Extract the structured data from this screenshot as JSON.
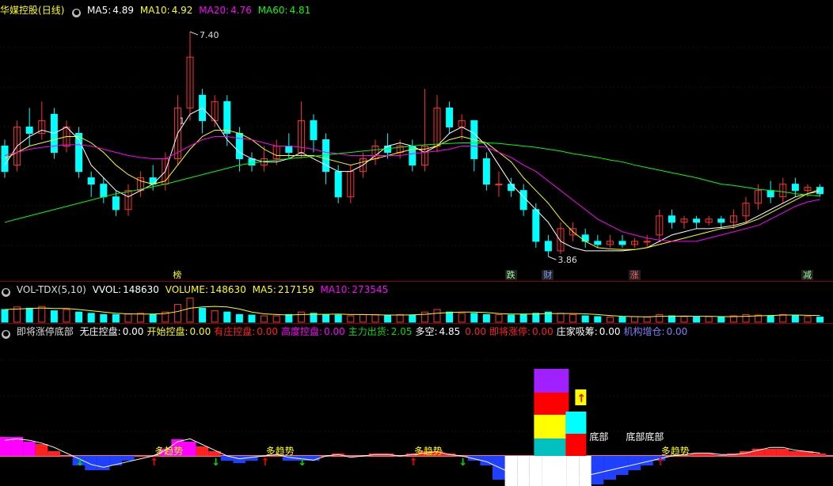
{
  "header_main": {
    "stock": "华媒控股",
    "period": "(日线)",
    "ma5_label": "MA5:",
    "ma5": "4.89",
    "ma10_label": "MA10:",
    "ma10": "4.92",
    "ma20_label": "MA20:",
    "ma20": "4.76",
    "ma60_label": "MA60:",
    "ma60": "4.81"
  },
  "header_vol": {
    "name": "VOL-TDX(5,10)",
    "vvol_label": "VVOL:",
    "vvol": "148630",
    "volume_label": "VOLUME:",
    "volume": "148630",
    "ma5_label": "MA5:",
    "ma5": "217159",
    "ma10_label": "MA10:",
    "ma10": "273545"
  },
  "header_ind": {
    "name": "即将涨停底部",
    "items": [
      {
        "label": "无庄控盘:",
        "value": "0.00",
        "color": "#ffffff"
      },
      {
        "label": "开始控盘:",
        "value": "0.00",
        "color": "#ffff00"
      },
      {
        "label": "有庄控盘:",
        "value": "0.00",
        "color": "#ff2020"
      },
      {
        "label": "高度控盘:",
        "value": "0.00",
        "color": "#ff00ff"
      },
      {
        "label": "主力出货:",
        "value": "2.05",
        "color": "#00dd00"
      },
      {
        "label": "多空:",
        "value": "4.85",
        "color": "#ffffff"
      },
      {
        "label": "",
        "value": "0.00",
        "color": "#ff2020"
      },
      {
        "label": "即将涨停:",
        "value": "0.00",
        "color": "#ff2020"
      },
      {
        "label": "庄家吸筹:",
        "value": "0.00",
        "color": "#ffffff"
      },
      {
        "label": "机构增仓:",
        "value": "0.00",
        "color": "#8080ff"
      }
    ]
  },
  "colors": {
    "up": "#ff3232",
    "down": "#00ffff",
    "ma5": "#ffffff",
    "ma10": "#ffff00",
    "ma20": "#ff00ff",
    "ma60": "#00ff00",
    "separator": "#8b0000"
  },
  "annotations": {
    "high": "7.40",
    "low": "3.86",
    "marker_1": "1",
    "event_tags": [
      "榜",
      "跌",
      "财",
      "涨",
      "减"
    ],
    "bottom_labels": [
      "底部",
      "底部底部"
    ],
    "trend_label": "多趋势"
  },
  "chart_data": [
    {
      "type": "candlestick",
      "title": "华媒控股 (日线)",
      "ylim": [
        3.6,
        7.6
      ],
      "series": [
        {
          "name": "MA5",
          "values": [
            5.3,
            5.6,
            5.75,
            5.85,
            5.8,
            5.9,
            5.7,
            5.3,
            5.1,
            4.9,
            4.8,
            4.9,
            5.0,
            5.2,
            5.8,
            6.1,
            6.2,
            6.0,
            5.7,
            5.5,
            5.4,
            5.35,
            5.35,
            5.4,
            5.5,
            5.4,
            5.3,
            5.2,
            5.2,
            5.3,
            5.45,
            5.6,
            5.65,
            5.6,
            5.5,
            5.6,
            5.8,
            5.9,
            5.8,
            5.6,
            5.3,
            5.0,
            4.8,
            4.6,
            4.4,
            4.1,
            4.0,
            3.95,
            3.95,
            3.95,
            3.95,
            3.97,
            4.0,
            4.1,
            4.2,
            4.25,
            4.3,
            4.3,
            4.32,
            4.35,
            4.4,
            4.5,
            4.6,
            4.7,
            4.8,
            4.85,
            4.89
          ]
        },
        {
          "name": "MA10",
          "values": [
            5.4,
            5.5,
            5.6,
            5.65,
            5.7,
            5.75,
            5.75,
            5.65,
            5.5,
            5.3,
            5.15,
            5.05,
            5.0,
            5.05,
            5.3,
            5.55,
            5.75,
            5.85,
            5.85,
            5.8,
            5.7,
            5.55,
            5.45,
            5.45,
            5.45,
            5.45,
            5.4,
            5.35,
            5.3,
            5.35,
            5.4,
            5.45,
            5.5,
            5.55,
            5.55,
            5.6,
            5.7,
            5.75,
            5.7,
            5.65,
            5.5,
            5.35,
            5.1,
            4.9,
            4.7,
            4.45,
            4.25,
            4.1,
            4.0,
            3.98,
            3.97,
            3.97,
            4.0,
            4.05,
            4.1,
            4.15,
            4.2,
            4.25,
            4.3,
            4.32,
            4.38,
            4.45,
            4.55,
            4.65,
            4.75,
            4.85,
            4.92
          ]
        },
        {
          "name": "MA20",
          "values": [
            5.45,
            5.5,
            5.55,
            5.58,
            5.6,
            5.62,
            5.62,
            5.6,
            5.55,
            5.5,
            5.45,
            5.42,
            5.4,
            5.4,
            5.5,
            5.6,
            5.7,
            5.75,
            5.75,
            5.72,
            5.7,
            5.65,
            5.6,
            5.6,
            5.58,
            5.55,
            5.5,
            5.48,
            5.45,
            5.45,
            5.45,
            5.45,
            5.45,
            5.48,
            5.5,
            5.52,
            5.55,
            5.6,
            5.6,
            5.58,
            5.5,
            5.42,
            5.3,
            5.2,
            5.05,
            4.9,
            4.75,
            4.6,
            4.45,
            4.35,
            4.25,
            4.2,
            4.15,
            4.12,
            4.1,
            4.1,
            4.1,
            4.15,
            4.2,
            4.25,
            4.3,
            4.35,
            4.45,
            4.55,
            4.65,
            4.72,
            4.76
          ]
        },
        {
          "name": "MA60",
          "values": [
            4.4,
            4.45,
            4.5,
            4.55,
            4.6,
            4.65,
            4.7,
            4.75,
            4.8,
            4.85,
            4.88,
            4.92,
            4.96,
            5.0,
            5.05,
            5.1,
            5.15,
            5.2,
            5.25,
            5.3,
            5.33,
            5.36,
            5.38,
            5.4,
            5.42,
            5.44,
            5.46,
            5.48,
            5.5,
            5.52,
            5.54,
            5.56,
            5.58,
            5.6,
            5.62,
            5.63,
            5.64,
            5.65,
            5.65,
            5.65,
            5.64,
            5.62,
            5.6,
            5.58,
            5.55,
            5.52,
            5.48,
            5.45,
            5.42,
            5.38,
            5.35,
            5.3,
            5.26,
            5.22,
            5.18,
            5.14,
            5.1,
            5.05,
            5.0,
            4.98,
            4.95,
            4.92,
            4.9,
            4.88,
            4.85,
            4.83,
            4.81
          ]
        }
      ],
      "candles": [
        [
          5.6,
          5.2,
          5.7,
          5.1
        ],
        [
          5.3,
          5.9,
          6.0,
          5.2
        ],
        [
          5.9,
          5.8,
          6.2,
          5.6
        ],
        [
          5.8,
          6.0,
          6.3,
          5.7
        ],
        [
          6.1,
          5.5,
          6.2,
          5.4
        ],
        [
          5.6,
          5.9,
          6.0,
          5.5
        ],
        [
          5.8,
          5.2,
          5.9,
          5.1
        ],
        [
          5.1,
          5.0,
          5.2,
          4.8
        ],
        [
          5.0,
          4.8,
          5.1,
          4.7
        ],
        [
          4.8,
          4.6,
          4.9,
          4.5
        ],
        [
          4.6,
          4.9,
          5.0,
          4.5
        ],
        [
          4.9,
          5.1,
          5.2,
          4.8
        ],
        [
          5.1,
          5.0,
          5.3,
          4.9
        ],
        [
          5.0,
          5.4,
          5.5,
          4.9
        ],
        [
          5.4,
          6.2,
          6.4,
          5.3
        ],
        [
          6.2,
          7.0,
          7.4,
          6.0
        ],
        [
          6.4,
          6.0,
          6.5,
          5.8
        ],
        [
          6.0,
          6.3,
          6.4,
          5.9
        ],
        [
          6.3,
          5.8,
          6.4,
          5.6
        ],
        [
          5.8,
          5.4,
          5.9,
          5.2
        ],
        [
          5.4,
          5.3,
          5.5,
          5.2
        ],
        [
          5.3,
          5.4,
          5.6,
          5.2
        ],
        [
          5.4,
          5.6,
          5.7,
          5.3
        ],
        [
          5.6,
          5.5,
          5.8,
          5.4
        ],
        [
          5.5,
          6.0,
          6.3,
          5.4
        ],
        [
          6.0,
          5.7,
          6.1,
          5.5
        ],
        [
          5.7,
          5.2,
          5.8,
          5.0
        ],
        [
          5.2,
          4.8,
          5.3,
          4.7
        ],
        [
          4.8,
          5.2,
          5.3,
          4.7
        ],
        [
          5.2,
          5.4,
          5.5,
          5.1
        ],
        [
          5.4,
          5.6,
          5.7,
          5.3
        ],
        [
          5.6,
          5.5,
          5.8,
          5.4
        ],
        [
          5.5,
          5.6,
          5.7,
          5.4
        ],
        [
          5.6,
          5.3,
          5.7,
          5.2
        ],
        [
          5.3,
          5.6,
          6.5,
          5.2
        ],
        [
          5.6,
          6.2,
          6.4,
          5.5
        ],
        [
          6.2,
          5.9,
          6.3,
          5.8
        ],
        [
          5.9,
          6.0,
          6.1,
          5.7
        ],
        [
          6.0,
          5.4,
          6.0,
          5.2
        ],
        [
          5.4,
          5.0,
          5.5,
          4.9
        ],
        [
          5.0,
          5.0,
          5.2,
          4.8
        ],
        [
          5.0,
          4.9,
          5.1,
          4.8
        ],
        [
          4.9,
          4.6,
          5.0,
          4.5
        ],
        [
          4.6,
          4.1,
          4.7,
          4.0
        ],
        [
          4.1,
          3.95,
          4.2,
          3.86
        ],
        [
          3.95,
          4.3,
          4.4,
          3.9
        ],
        [
          4.2,
          4.3,
          4.4,
          4.1
        ],
        [
          4.2,
          4.1,
          4.3,
          4.0
        ],
        [
          4.1,
          4.05,
          4.2,
          4.0
        ],
        [
          4.05,
          4.1,
          4.2,
          4.0
        ],
        [
          4.1,
          4.05,
          4.2,
          4.0
        ],
        [
          4.05,
          4.1,
          4.15,
          4.0
        ],
        [
          4.1,
          4.1,
          4.2,
          4.0
        ],
        [
          4.2,
          4.5,
          4.6,
          4.1
        ],
        [
          4.5,
          4.4,
          4.6,
          4.3
        ],
        [
          4.4,
          4.45,
          4.5,
          4.3
        ],
        [
          4.45,
          4.4,
          4.5,
          4.3
        ],
        [
          4.4,
          4.45,
          4.5,
          4.35
        ],
        [
          4.45,
          4.4,
          4.5,
          4.3
        ],
        [
          4.4,
          4.5,
          4.6,
          4.3
        ],
        [
          4.5,
          4.7,
          4.8,
          4.4
        ],
        [
          4.7,
          4.9,
          5.0,
          4.6
        ],
        [
          4.9,
          4.8,
          5.05,
          4.7
        ],
        [
          4.8,
          5.0,
          5.1,
          4.7
        ],
        [
          5.0,
          4.9,
          5.1,
          4.8
        ],
        [
          4.9,
          4.95,
          5.0,
          4.8
        ],
        [
          4.95,
          4.85,
          5.0,
          4.8
        ]
      ]
    },
    {
      "type": "bar",
      "title": "VOL-TDX(5,10)",
      "ylim": [
        0,
        1
      ],
      "values": [
        0.5,
        0.6,
        0.55,
        0.62,
        0.45,
        0.5,
        0.4,
        0.35,
        0.3,
        0.3,
        0.32,
        0.35,
        0.3,
        0.4,
        0.7,
        0.95,
        0.55,
        0.45,
        0.4,
        0.3,
        0.28,
        0.25,
        0.25,
        0.3,
        0.4,
        0.35,
        0.3,
        0.28,
        0.25,
        0.3,
        0.3,
        0.28,
        0.3,
        0.28,
        0.4,
        0.5,
        0.4,
        0.35,
        0.35,
        0.3,
        0.3,
        0.28,
        0.3,
        0.35,
        0.4,
        0.35,
        0.3,
        0.25,
        0.22,
        0.2,
        0.2,
        0.22,
        0.2,
        0.3,
        0.25,
        0.22,
        0.2,
        0.22,
        0.2,
        0.25,
        0.3,
        0.28,
        0.25,
        0.3,
        0.28,
        0.22,
        0.2
      ],
      "ma5_values": [
        0.5,
        0.52,
        0.54,
        0.56,
        0.54,
        0.54,
        0.5,
        0.45,
        0.4,
        0.35,
        0.33,
        0.32,
        0.32,
        0.34,
        0.42,
        0.55,
        0.6,
        0.62,
        0.6,
        0.52,
        0.4,
        0.33,
        0.3,
        0.28,
        0.3,
        0.31,
        0.31,
        0.32,
        0.3,
        0.3,
        0.29,
        0.28,
        0.28,
        0.29,
        0.31,
        0.35,
        0.38,
        0.4,
        0.4,
        0.38,
        0.34,
        0.32,
        0.32,
        0.32,
        0.34,
        0.34,
        0.34,
        0.33,
        0.3,
        0.26,
        0.23,
        0.22,
        0.21,
        0.23,
        0.23,
        0.24,
        0.23,
        0.23,
        0.22,
        0.22,
        0.23,
        0.25,
        0.26,
        0.28,
        0.28,
        0.27,
        0.26
      ]
    },
    {
      "type": "area",
      "title": "即将涨停底部",
      "ylim": [
        -1,
        3
      ],
      "series": [
        {
          "name": "多空",
          "values": [
            0.55,
            0.6,
            0.55,
            0.45,
            0.3,
            0.1,
            -0.1,
            -0.3,
            -0.4,
            -0.3,
            -0.2,
            -0.1,
            0.0,
            0.2,
            0.5,
            0.6,
            0.4,
            0.2,
            0.0,
            -0.1,
            -0.05,
            0.0,
            0.05,
            -0.05,
            -0.1,
            -0.15,
            0.0,
            0.05,
            -0.05,
            0.0,
            0.05,
            0.05,
            0.0,
            0.05,
            0.1,
            0.15,
            0.05,
            0.0,
            -0.1,
            -0.2,
            -0.4,
            -0.6,
            -0.8,
            -0.9,
            -0.95,
            -0.9,
            -0.8,
            -0.7,
            -0.6,
            -0.5,
            -0.4,
            -0.3,
            -0.2,
            -0.1,
            0.0,
            0.05,
            0.1,
            0.1,
            0.05,
            0.05,
            0.1,
            0.2,
            0.3,
            0.3,
            0.2,
            0.15,
            0.1
          ]
        }
      ],
      "bars": [
        0.4,
        0.4,
        0.3,
        0.25,
        0.1,
        0.0,
        -0.2,
        -0.3,
        -0.3,
        -0.2,
        -0.1,
        0.0,
        0.0,
        0.15,
        0.35,
        0.3,
        0.2,
        0.1,
        -0.1,
        -0.15,
        -0.1,
        0.0,
        0.0,
        -0.1,
        -0.1,
        -0.1,
        0.0,
        0.05,
        0.0,
        0.0,
        0.05,
        0.05,
        0.0,
        0.05,
        0.1,
        0.1,
        0.05,
        0.0,
        -0.1,
        -0.2,
        -0.5,
        -0.7,
        -0.9,
        -0.95,
        -0.95,
        -0.9,
        -0.8,
        -0.7,
        -0.6,
        -0.5,
        -0.4,
        -0.3,
        -0.2,
        -0.1,
        0.0,
        0.0,
        0.05,
        0.05,
        0.0,
        0.05,
        0.1,
        0.15,
        0.15,
        0.15,
        0.1,
        0.1,
        0.05
      ],
      "stack_index": 44,
      "stack_levels": [
        0.4,
        0.5,
        0.6,
        0.6,
        0.6
      ]
    }
  ]
}
